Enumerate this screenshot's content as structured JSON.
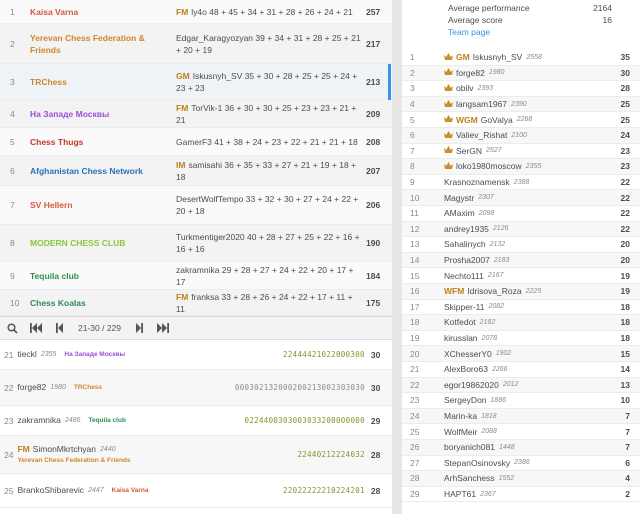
{
  "teams": [
    {
      "rank": "1",
      "name": "Kaisa Varna",
      "color": "#d05b3c",
      "title": "FM",
      "leader": "ly4o",
      "scores": "48 + 45 + 34 + 31 + 28 + 26 + 24 + 21",
      "points": "257"
    },
    {
      "rank": "2",
      "name": "Yerevan Chess Federation & Friends",
      "color": "#d0862a",
      "title": "",
      "leader": "Edgar_Karagyozyan",
      "scores": "39 + 34 + 31 + 28 + 25 + 21 + 20 + 19",
      "points": "217"
    },
    {
      "rank": "3",
      "name": "TRChess",
      "color": "#d0862a",
      "title": "GM",
      "leader": "Iskusnyh_SV",
      "scores": "35 + 30 + 28 + 25 + 25 + 24 + 23 + 23",
      "points": "213"
    },
    {
      "rank": "4",
      "name": "На Западе Москвы",
      "color": "#9b4fd6",
      "title": "FM",
      "leader": "TorVik-1",
      "scores": "36 + 30 + 30 + 25 + 23 + 23 + 21 + 21",
      "points": "209"
    },
    {
      "rank": "5",
      "name": "Chess Thugs",
      "color": "#c0392b",
      "title": "",
      "leader": "GamerF3",
      "scores": "41 + 38 + 24 + 23 + 22 + 21 + 21 + 18",
      "points": "208"
    },
    {
      "rank": "6",
      "name": "Afghanistan Chess Network",
      "color": "#2a6fb8",
      "title": "IM",
      "leader": "samisahi",
      "scores": "36 + 35 + 33 + 27 + 21 + 19 + 18 + 18",
      "points": "207"
    },
    {
      "rank": "7",
      "name": "SV Hellern",
      "color": "#d05b3c",
      "title": "",
      "leader": "DesertWolfTempo",
      "scores": "33 + 32 + 30 + 27 + 24 + 22 + 20 + 18",
      "points": "206"
    },
    {
      "rank": "8",
      "name": "MODERN CHESS CLUB",
      "color": "#8cc63f",
      "title": "",
      "leader": "Turkmentiger2020",
      "scores": "40 + 28 + 27 + 25 + 22 + 16 + 16 + 16",
      "points": "190"
    },
    {
      "rank": "9",
      "name": "Tequila club",
      "color": "#2e8b57",
      "title": "",
      "leader": "zakramnika",
      "scores": "29 + 28 + 27 + 24 + 22 + 20 + 17 + 17",
      "points": "184"
    },
    {
      "rank": "10",
      "name": "Chess Koalas",
      "color": "#2e8b57",
      "title": "FM",
      "leader": "franksa",
      "scores": "33 + 28 + 26 + 24 + 22 + 17 + 11 + 11",
      "points": "175"
    }
  ],
  "pager": {
    "info": "21-30 / 229",
    "search_icon": "search-icon",
    "first_icon": "first-page-icon",
    "prev_icon": "prev-page-icon",
    "next_icon": "next-page-icon",
    "last_icon": "last-page-icon"
  },
  "players": [
    {
      "rank": "21",
      "name": "tieckl",
      "rating": "2355",
      "team": "На Западе Москвы",
      "team_color": "#9b4fd6",
      "title": "",
      "seq": "22444421022000300",
      "seq_color": "green",
      "total": "30"
    },
    {
      "rank": "22",
      "name": "forge82",
      "rating": "1980",
      "team": "TRChess",
      "team_color": "#d0862a",
      "title": "",
      "seq": "000302132000200213002303030",
      "seq_color": "grey",
      "total": "30"
    },
    {
      "rank": "23",
      "name": "zakramnika",
      "rating": "2486",
      "team": "Tequila club",
      "team_color": "#2e8b57",
      "title": "",
      "seq": "0224400303003033200000000",
      "seq_color": "green",
      "total": "29"
    },
    {
      "rank": "24",
      "name": "SimonMkrtchyan",
      "rating": "2440",
      "team": "Yerevan Chess Federation & Friends",
      "team_color": "#d0862a",
      "title": "FM",
      "seq": "22440212224032",
      "seq_color": "green",
      "total": "28"
    },
    {
      "rank": "25",
      "name": "BrankoShibarevic",
      "rating": "2447",
      "team": "Kaisa Varna",
      "team_color": "#d05b3c",
      "title": "",
      "seq": "22022222210224201",
      "seq_color": "green",
      "total": "28"
    }
  ],
  "summary": {
    "avg_perf_label": "Average performance",
    "avg_perf_value": "2164",
    "avg_score_label": "Average score",
    "avg_score_value": "16",
    "team_page_link": "Team page"
  },
  "roster": [
    {
      "rank": "1",
      "crown": true,
      "title": "GM",
      "name": "Iskusnyh_SV",
      "rating": "2558",
      "score": "35"
    },
    {
      "rank": "2",
      "crown": true,
      "title": "",
      "name": "forge82",
      "rating": "1980",
      "score": "30"
    },
    {
      "rank": "3",
      "crown": true,
      "title": "",
      "name": "obilv",
      "rating": "2393",
      "score": "28"
    },
    {
      "rank": "4",
      "crown": true,
      "title": "",
      "name": "langsam1967",
      "rating": "2390",
      "score": "25"
    },
    {
      "rank": "5",
      "crown": true,
      "title": "WGM",
      "name": "GoValya",
      "rating": "2268",
      "score": "25"
    },
    {
      "rank": "6",
      "crown": true,
      "title": "",
      "name": "Valiev_Rishat",
      "rating": "2100",
      "score": "24"
    },
    {
      "rank": "7",
      "crown": true,
      "title": "",
      "name": "SerGN",
      "rating": "2527",
      "score": "23"
    },
    {
      "rank": "8",
      "crown": true,
      "title": "",
      "name": "loko1980moscow",
      "rating": "2355",
      "score": "23"
    },
    {
      "rank": "9",
      "crown": false,
      "title": "",
      "name": "Krasnoznamensk",
      "rating": "2388",
      "score": "22"
    },
    {
      "rank": "10",
      "crown": false,
      "title": "",
      "name": "Magystr",
      "rating": "2307",
      "score": "22"
    },
    {
      "rank": "11",
      "crown": false,
      "title": "",
      "name": "AMaxim",
      "rating": "2098",
      "score": "22"
    },
    {
      "rank": "12",
      "crown": false,
      "title": "",
      "name": "andrey1935",
      "rating": "2126",
      "score": "22"
    },
    {
      "rank": "13",
      "crown": false,
      "title": "",
      "name": "Sahalinych",
      "rating": "2132",
      "score": "20"
    },
    {
      "rank": "14",
      "crown": false,
      "title": "",
      "name": "Prosha2007",
      "rating": "2183",
      "score": "20"
    },
    {
      "rank": "15",
      "crown": false,
      "title": "",
      "name": "Nechto111",
      "rating": "2167",
      "score": "19"
    },
    {
      "rank": "16",
      "crown": false,
      "title": "WFM",
      "name": "Idrisova_Roza",
      "rating": "2225",
      "score": "19"
    },
    {
      "rank": "17",
      "crown": false,
      "title": "",
      "name": "Skipper-11",
      "rating": "2082",
      "score": "18"
    },
    {
      "rank": "18",
      "crown": false,
      "title": "",
      "name": "Kotfedot",
      "rating": "2182",
      "score": "18"
    },
    {
      "rank": "19",
      "crown": false,
      "title": "",
      "name": "kirusslan",
      "rating": "2078",
      "score": "18"
    },
    {
      "rank": "20",
      "crown": false,
      "title": "",
      "name": "XChesserY0",
      "rating": "1902",
      "score": "15"
    },
    {
      "rank": "21",
      "crown": false,
      "title": "",
      "name": "AlexBoro63",
      "rating": "2266",
      "score": "14"
    },
    {
      "rank": "22",
      "crown": false,
      "title": "",
      "name": "egor19862020",
      "rating": "2012",
      "score": "13"
    },
    {
      "rank": "23",
      "crown": false,
      "title": "",
      "name": "SergeyDon",
      "rating": "1886",
      "score": "10"
    },
    {
      "rank": "24",
      "crown": false,
      "title": "",
      "name": "Marin-ka",
      "rating": "1818",
      "score": "7"
    },
    {
      "rank": "25",
      "crown": false,
      "title": "",
      "name": "WolfMeir",
      "rating": "2088",
      "score": "7"
    },
    {
      "rank": "26",
      "crown": false,
      "title": "",
      "name": "boryanich081",
      "rating": "1448",
      "score": "7"
    },
    {
      "rank": "27",
      "crown": false,
      "title": "",
      "name": "StepanOsinovsky",
      "rating": "2386",
      "score": "6"
    },
    {
      "rank": "28",
      "crown": false,
      "title": "",
      "name": "ArhSanchess",
      "rating": "1552",
      "score": "4"
    },
    {
      "rank": "29",
      "crown": false,
      "title": "",
      "name": "HAPT61",
      "rating": "2367",
      "score": "2"
    }
  ]
}
